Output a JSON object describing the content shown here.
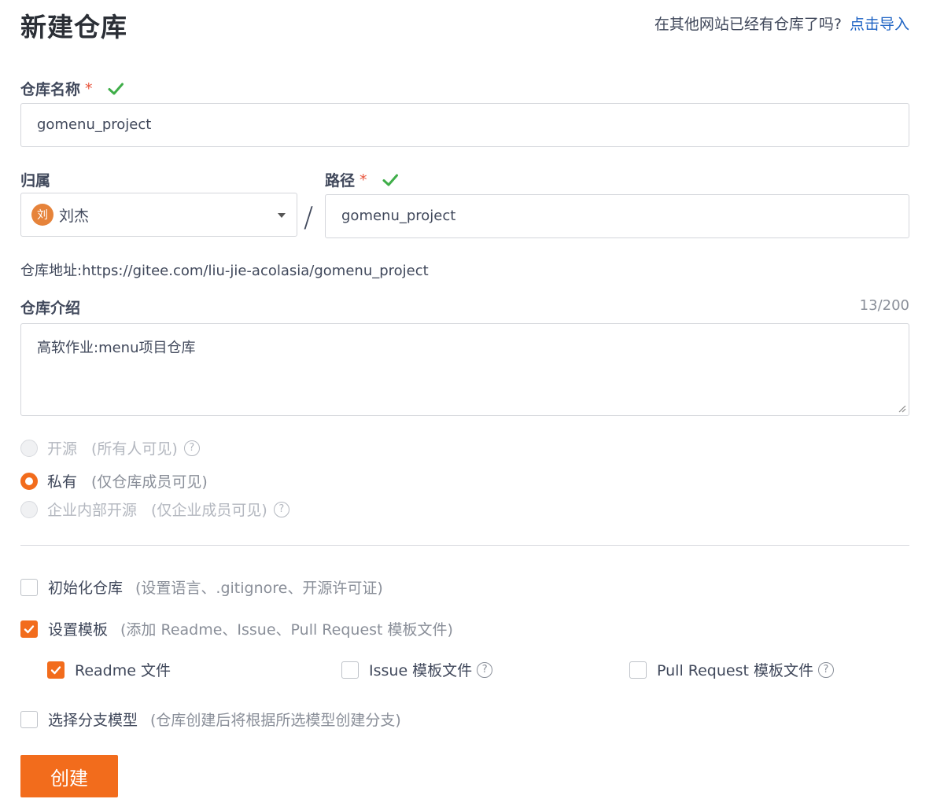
{
  "header": {
    "title": "新建仓库",
    "import_prompt": "在其他网站已经有仓库了吗?",
    "import_link": "点击导入"
  },
  "repo_name": {
    "label": "仓库名称",
    "required_mark": "*",
    "value": "gomenu_project"
  },
  "owner": {
    "label": "归属",
    "avatar_text": "刘",
    "name": "刘杰",
    "avatar_color": "#e6833a"
  },
  "path": {
    "separator": "/",
    "label": "路径",
    "required_mark": "*",
    "value": "gomenu_project"
  },
  "repo_url": {
    "text": "仓库地址:https://gitee.com/liu-jie-acolasia/gomenu_project"
  },
  "description": {
    "label": "仓库介绍",
    "count": "13/200",
    "value": "高软作业:menu项目仓库"
  },
  "visibility": {
    "options": [
      {
        "label": "开源",
        "hint": "(所有人可见)",
        "selected": false,
        "disabled": true,
        "help": true
      },
      {
        "label": "私有",
        "hint": "(仅仓库成员可见)",
        "selected": true,
        "disabled": false,
        "help": false
      },
      {
        "label": "企业内部开源",
        "hint": "(仅企业成员可见)",
        "selected": false,
        "disabled": true,
        "help": true
      }
    ]
  },
  "init_repo": {
    "label": "初始化仓库",
    "hint": "(设置语言、.gitignore、开源许可证)",
    "checked": false
  },
  "templates": {
    "label": "设置模板",
    "hint": "(添加 Readme、Issue、Pull Request 模板文件)",
    "checked": true,
    "items": [
      {
        "label": "Readme 文件",
        "checked": true
      },
      {
        "label": "Issue 模板文件",
        "checked": false
      },
      {
        "label": "Pull Request 模板文件",
        "checked": false
      }
    ]
  },
  "branch_model": {
    "label": "选择分支模型",
    "hint": "(仓库创建后将根据所选模型创建分支)",
    "checked": false
  },
  "submit": {
    "label": "创建"
  },
  "colors": {
    "accent": "#f26c1c",
    "link": "#1f64c4",
    "success": "#3fae49",
    "required": "#e8543c"
  }
}
